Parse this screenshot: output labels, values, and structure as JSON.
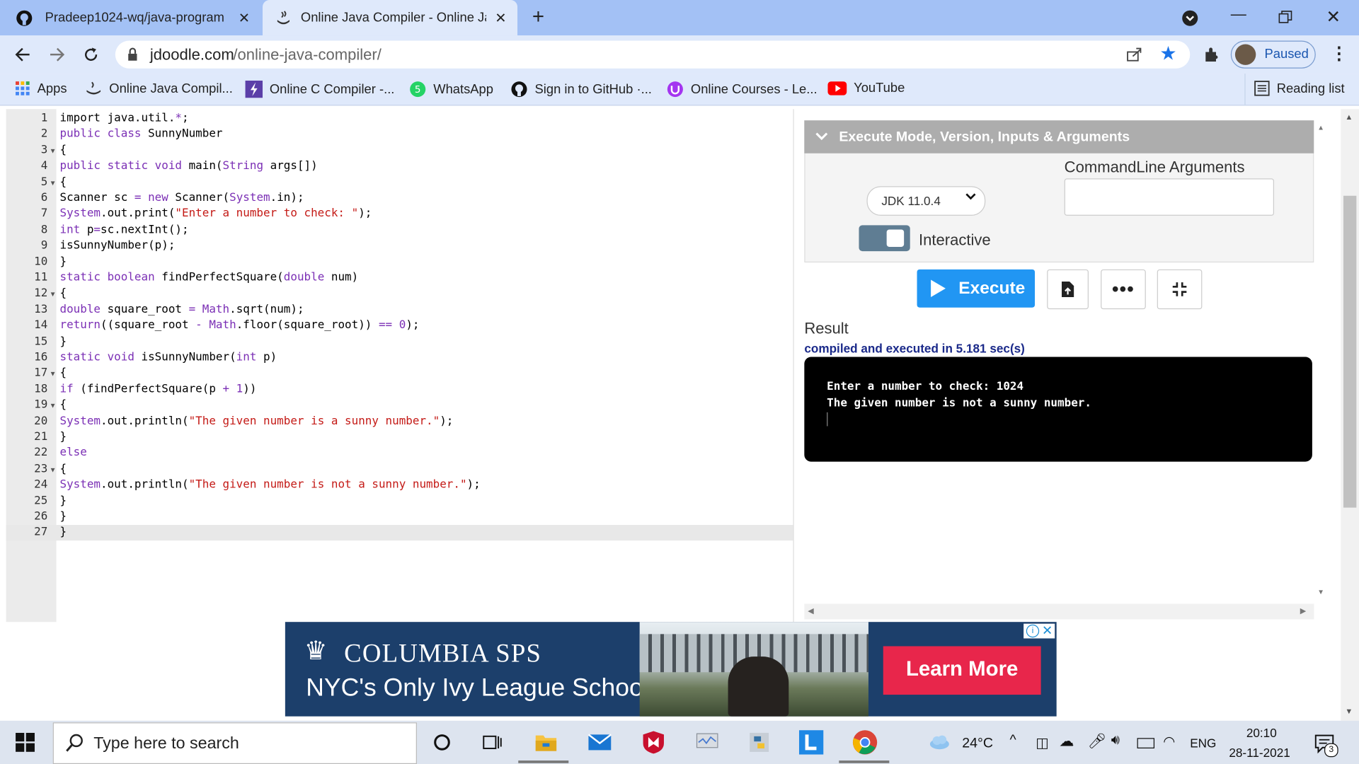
{
  "browser": {
    "tabs": [
      {
        "title": "Pradeep1024-wq/java-program",
        "icon": "github-icon"
      },
      {
        "title": "Online Java Compiler - Online Ja",
        "icon": "jdoodle-icon"
      }
    ],
    "new_tab": "+",
    "url_domain": "jdoodle.com",
    "url_path": "/online-java-compiler/",
    "profile_label": "Paused",
    "bookmarks": [
      {
        "label": "Apps",
        "icon": "apps-grid-icon"
      },
      {
        "label": "Online Java Compil...",
        "icon": "jdoodle-icon"
      },
      {
        "label": "Online C Compiler -...",
        "icon": "lightning-icon"
      },
      {
        "label": "WhatsApp",
        "icon": "whatsapp-icon"
      },
      {
        "label": "Sign in to GitHub ·...",
        "icon": "github-icon"
      },
      {
        "label": "Online Courses - Le...",
        "icon": "udemy-icon"
      },
      {
        "label": "YouTube",
        "icon": "youtube-icon"
      }
    ],
    "reading_list": "Reading list"
  },
  "editor": {
    "lines": [
      {
        "n": "1",
        "fold": false,
        "t": [
          [
            "import java.util.",
            "d"
          ],
          [
            "*",
            "k"
          ],
          [
            ";",
            "d"
          ]
        ]
      },
      {
        "n": "2",
        "fold": false,
        "t": [
          [
            "public class",
            "k"
          ],
          [
            " SunnyNumber",
            "d"
          ]
        ]
      },
      {
        "n": "3",
        "fold": true,
        "t": [
          [
            "{",
            "d"
          ]
        ]
      },
      {
        "n": "4",
        "fold": false,
        "t": [
          [
            "public static void",
            "k"
          ],
          [
            " main(",
            "d"
          ],
          [
            "String",
            "k"
          ],
          [
            " args[])",
            "d"
          ]
        ]
      },
      {
        "n": "5",
        "fold": true,
        "t": [
          [
            "{",
            "d"
          ]
        ]
      },
      {
        "n": "6",
        "fold": false,
        "t": [
          [
            "Scanner sc ",
            "d"
          ],
          [
            "=",
            "k"
          ],
          [
            " ",
            "d"
          ],
          [
            "new",
            "k"
          ],
          [
            " Scanner(",
            "d"
          ],
          [
            "System",
            "k"
          ],
          [
            ".in);",
            "d"
          ]
        ]
      },
      {
        "n": "7",
        "fold": false,
        "t": [
          [
            "System",
            "k"
          ],
          [
            ".out.print(",
            "d"
          ],
          [
            "\"Enter a number to check: \"",
            "s"
          ],
          [
            ");",
            "d"
          ]
        ]
      },
      {
        "n": "8",
        "fold": false,
        "t": [
          [
            "int",
            "k"
          ],
          [
            " p",
            "d"
          ],
          [
            "=",
            "k"
          ],
          [
            "sc.nextInt();",
            "d"
          ]
        ]
      },
      {
        "n": "9",
        "fold": false,
        "t": [
          [
            "isSunnyNumber(p);",
            "d"
          ]
        ]
      },
      {
        "n": "10",
        "fold": false,
        "t": [
          [
            "}",
            "d"
          ]
        ]
      },
      {
        "n": "11",
        "fold": false,
        "t": [
          [
            "static boolean",
            "k"
          ],
          [
            " findPerfectSquare(",
            "d"
          ],
          [
            "double",
            "k"
          ],
          [
            " num)",
            "d"
          ]
        ]
      },
      {
        "n": "12",
        "fold": true,
        "t": [
          [
            "{",
            "d"
          ]
        ]
      },
      {
        "n": "13",
        "fold": false,
        "t": [
          [
            "double",
            "k"
          ],
          [
            " square_root ",
            "d"
          ],
          [
            "=",
            "k"
          ],
          [
            " ",
            "d"
          ],
          [
            "Math",
            "k"
          ],
          [
            ".sqrt(num);",
            "d"
          ]
        ]
      },
      {
        "n": "14",
        "fold": false,
        "t": [
          [
            "return",
            "k"
          ],
          [
            "((square_root ",
            "d"
          ],
          [
            "-",
            "k"
          ],
          [
            " ",
            "d"
          ],
          [
            "Math",
            "k"
          ],
          [
            ".floor(square_root)) ",
            "d"
          ],
          [
            "==",
            "k"
          ],
          [
            " ",
            "d"
          ],
          [
            "0",
            "k"
          ],
          [
            ");",
            "d"
          ]
        ]
      },
      {
        "n": "15",
        "fold": false,
        "t": [
          [
            "}",
            "d"
          ]
        ]
      },
      {
        "n": "16",
        "fold": false,
        "t": [
          [
            "static void",
            "k"
          ],
          [
            " isSunnyNumber(",
            "d"
          ],
          [
            "int",
            "k"
          ],
          [
            " p)",
            "d"
          ]
        ]
      },
      {
        "n": "17",
        "fold": true,
        "t": [
          [
            "{",
            "d"
          ]
        ]
      },
      {
        "n": "18",
        "fold": false,
        "t": [
          [
            "if",
            "k"
          ],
          [
            " (findPerfectSquare(p ",
            "d"
          ],
          [
            "+",
            "k"
          ],
          [
            " ",
            "d"
          ],
          [
            "1",
            "k"
          ],
          [
            "))",
            "d"
          ]
        ]
      },
      {
        "n": "19",
        "fold": true,
        "t": [
          [
            "{",
            "d"
          ]
        ]
      },
      {
        "n": "20",
        "fold": false,
        "t": [
          [
            "System",
            "k"
          ],
          [
            ".out.println(",
            "d"
          ],
          [
            "\"The given number is a sunny number.\"",
            "s"
          ],
          [
            ");",
            "d"
          ]
        ]
      },
      {
        "n": "21",
        "fold": false,
        "t": [
          [
            "}",
            "d"
          ]
        ]
      },
      {
        "n": "22",
        "fold": false,
        "t": [
          [
            "else",
            "k"
          ]
        ]
      },
      {
        "n": "23",
        "fold": true,
        "t": [
          [
            "{",
            "d"
          ]
        ]
      },
      {
        "n": "24",
        "fold": false,
        "t": [
          [
            "System",
            "k"
          ],
          [
            ".out.println(",
            "d"
          ],
          [
            "\"The given number is not a sunny number.\"",
            "s"
          ],
          [
            ");",
            "d"
          ]
        ]
      },
      {
        "n": "25",
        "fold": false,
        "t": [
          [
            "}",
            "d"
          ]
        ]
      },
      {
        "n": "26",
        "fold": false,
        "t": [
          [
            "}",
            "d"
          ]
        ]
      },
      {
        "n": "27",
        "fold": false,
        "t": [
          [
            "}",
            "d"
          ]
        ]
      }
    ]
  },
  "panel": {
    "accordion_title": "Execute Mode, Version, Inputs & Arguments",
    "cmd_args_label": "CommandLine Arguments",
    "cmd_args_value": "",
    "jdk_version": "JDK 11.0.4",
    "interactive_label": "Interactive",
    "execute_label": "Execute",
    "result_label": "Result",
    "result_status": "compiled and executed in 5.181 sec(s)",
    "console_lines": [
      "Enter a number to check: 1024",
      "The given number is not a sunny number."
    ]
  },
  "ad": {
    "brand": "COLUMBIA SPS",
    "tagline": "NYC's Only Ivy League School",
    "cta": "Learn More"
  },
  "taskbar": {
    "search_placeholder": "Type here to search",
    "weather": "24°C",
    "language": "ENG",
    "time": "20:10",
    "date": "28-11-2021",
    "notifications": "3"
  },
  "colors": {
    "tabstrip": "#a3c1f5",
    "toolbar": "#dfe9fb",
    "execute_button": "#2196f3",
    "keyword": "#7b2fb5",
    "string": "#c41a16",
    "ad_background": "#1c3f6b",
    "ad_cta": "#e8264b"
  }
}
